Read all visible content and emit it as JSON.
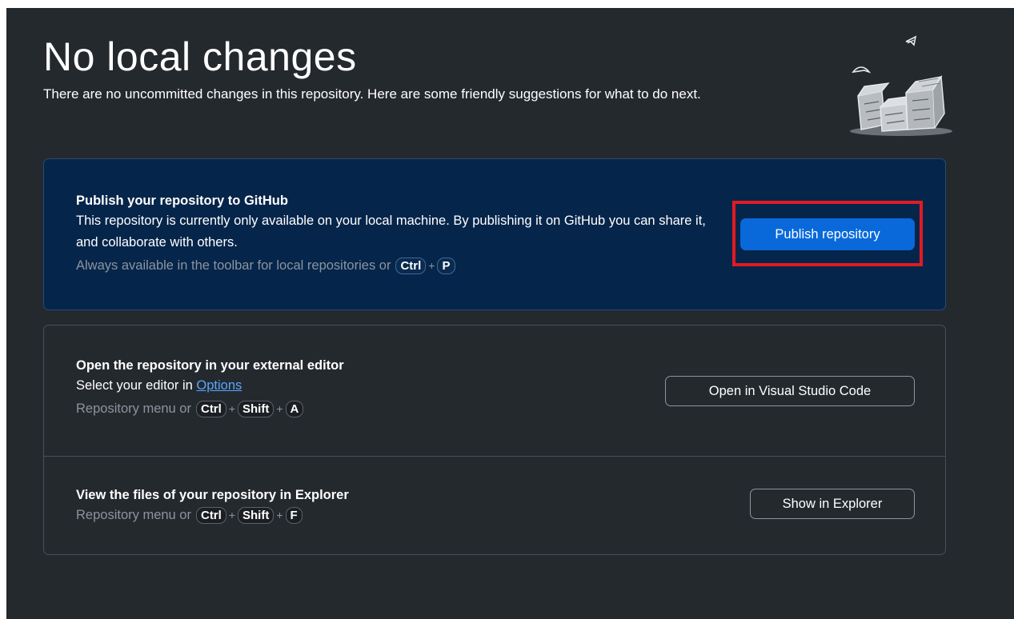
{
  "header": {
    "title": "No local changes",
    "subtitle": "There are no uncommitted changes in this repository. Here are some friendly suggestions for what to do next."
  },
  "publish": {
    "heading": "Publish your repository to GitHub",
    "description": "This repository is currently only available on your local machine. By publishing it on GitHub you can share it, and collaborate with others.",
    "hint_prefix": "Always available in the toolbar for local repositories or",
    "shortcut": [
      "Ctrl",
      "P"
    ],
    "button_label": "Publish repository"
  },
  "editor": {
    "heading": "Open the repository in your external editor",
    "description_prefix": "Select your editor in",
    "options_link": "Options",
    "hint_prefix": "Repository menu or",
    "shortcut": [
      "Ctrl",
      "Shift",
      "A"
    ],
    "button_label": "Open in Visual Studio Code"
  },
  "explorer": {
    "heading": "View the files of your repository in Explorer",
    "hint_prefix": "Repository menu or",
    "shortcut": [
      "Ctrl",
      "Shift",
      "F"
    ],
    "button_label": "Show in Explorer"
  },
  "shortcut_separator": "+",
  "colors": {
    "background": "#24292e",
    "publish_card": "#06254a",
    "primary_button": "#0969da",
    "highlight": "#e01b24",
    "link": "#58a6ff",
    "hint_text": "#8b949e"
  },
  "icons": {
    "illustration": "empty-boxes-illustration"
  }
}
